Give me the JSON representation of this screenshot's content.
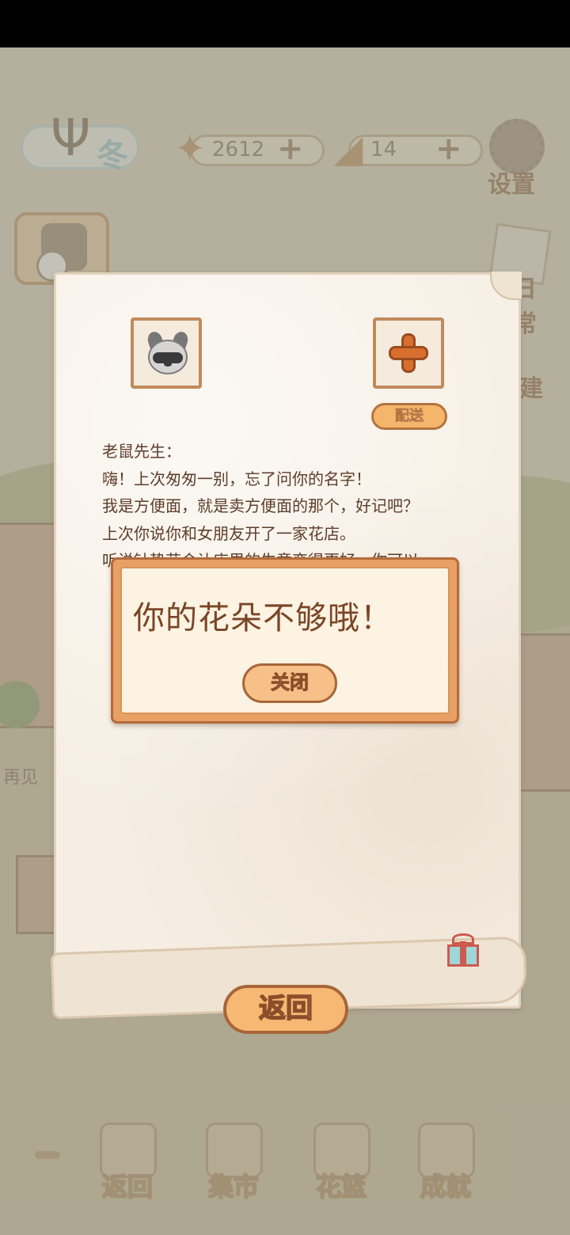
{
  "season": {
    "label": "冬"
  },
  "currencies": {
    "fish": {
      "value": "2612",
      "icon": "fish-bone-icon"
    },
    "cheese": {
      "value": "14",
      "icon": "cheese-icon"
    }
  },
  "settings": {
    "label": "设置"
  },
  "side_buttons": {
    "daily": "日常",
    "build": "建",
    "bye_sign": "再见"
  },
  "letter": {
    "sender_icon": "raccoon-avatar",
    "deliver_label": "配送",
    "lines": [
      "老鼠先生：",
      "嗨！上次匆匆一别，忘了问你的名字！",
      "我是方便面，就是卖方便面的那个，好记吧？",
      "上次你说你和女朋友开了一家花店。",
      "听说针垫花会让店里的生意变得更好，你可以"
    ],
    "return_label": "返回"
  },
  "alert": {
    "message": "你的花朵不够哦！",
    "close_label": "关闭"
  },
  "bottom_nav": {
    "items": [
      {
        "label": "返回",
        "icon": "window-icon"
      },
      {
        "label": "集市",
        "icon": "market-stall-icon"
      },
      {
        "label": "花篮",
        "icon": "flower-basket-icon"
      },
      {
        "label": "成就",
        "icon": "trophy-icon"
      }
    ]
  },
  "colors": {
    "accent_orange": "#f5b56b",
    "dialog_border": "#b36c3a",
    "text_brown": "#5d3d2a"
  }
}
